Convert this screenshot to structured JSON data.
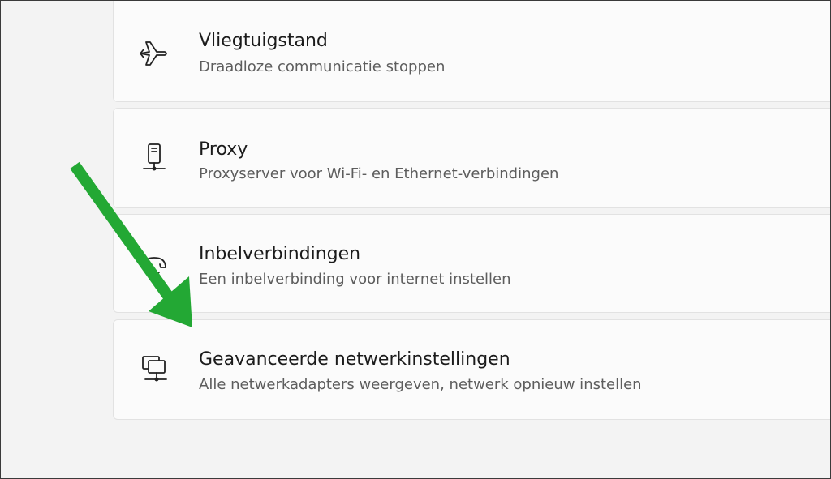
{
  "settings": {
    "items": [
      {
        "title": "Vliegtuigstand",
        "description": "Draadloze communicatie stoppen",
        "icon": "airplane-icon"
      },
      {
        "title": "Proxy",
        "description": "Proxyserver voor Wi-Fi- en Ethernet-verbindingen",
        "icon": "proxy-server-icon"
      },
      {
        "title": "Inbelverbindingen",
        "description": "Een inbelverbinding voor internet instellen",
        "icon": "dial-up-icon"
      },
      {
        "title": "Geavanceerde netwerkinstellingen",
        "description": "Alle netwerkadapters weergeven, netwerk opnieuw instellen",
        "icon": "network-adapter-icon"
      }
    ]
  },
  "annotation": {
    "arrow_color": "#23a834"
  }
}
